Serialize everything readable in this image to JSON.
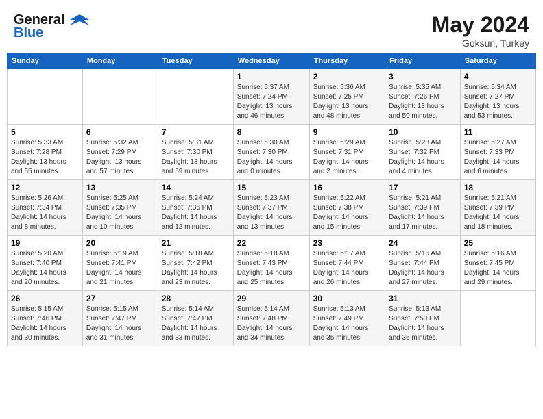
{
  "header": {
    "logo_line1": "General",
    "logo_line2": "Blue",
    "month_year": "May 2024",
    "location": "Goksun, Turkey"
  },
  "days_of_week": [
    "Sunday",
    "Monday",
    "Tuesday",
    "Wednesday",
    "Thursday",
    "Friday",
    "Saturday"
  ],
  "weeks": [
    {
      "days": [
        {
          "number": "",
          "info": ""
        },
        {
          "number": "",
          "info": ""
        },
        {
          "number": "",
          "info": ""
        },
        {
          "number": "1",
          "info": "Sunrise: 5:37 AM\nSunset: 7:24 PM\nDaylight: 13 hours\nand 46 minutes."
        },
        {
          "number": "2",
          "info": "Sunrise: 5:36 AM\nSunset: 7:25 PM\nDaylight: 13 hours\nand 48 minutes."
        },
        {
          "number": "3",
          "info": "Sunrise: 5:35 AM\nSunset: 7:26 PM\nDaylight: 13 hours\nand 50 minutes."
        },
        {
          "number": "4",
          "info": "Sunrise: 5:34 AM\nSunset: 7:27 PM\nDaylight: 13 hours\nand 53 minutes."
        }
      ]
    },
    {
      "days": [
        {
          "number": "5",
          "info": "Sunrise: 5:33 AM\nSunset: 7:28 PM\nDaylight: 13 hours\nand 55 minutes."
        },
        {
          "number": "6",
          "info": "Sunrise: 5:32 AM\nSunset: 7:29 PM\nDaylight: 13 hours\nand 57 minutes."
        },
        {
          "number": "7",
          "info": "Sunrise: 5:31 AM\nSunset: 7:30 PM\nDaylight: 13 hours\nand 59 minutes."
        },
        {
          "number": "8",
          "info": "Sunrise: 5:30 AM\nSunset: 7:30 PM\nDaylight: 14 hours\nand 0 minutes."
        },
        {
          "number": "9",
          "info": "Sunrise: 5:29 AM\nSunset: 7:31 PM\nDaylight: 14 hours\nand 2 minutes."
        },
        {
          "number": "10",
          "info": "Sunrise: 5:28 AM\nSunset: 7:32 PM\nDaylight: 14 hours\nand 4 minutes."
        },
        {
          "number": "11",
          "info": "Sunrise: 5:27 AM\nSunset: 7:33 PM\nDaylight: 14 hours\nand 6 minutes."
        }
      ]
    },
    {
      "days": [
        {
          "number": "12",
          "info": "Sunrise: 5:26 AM\nSunset: 7:34 PM\nDaylight: 14 hours\nand 8 minutes."
        },
        {
          "number": "13",
          "info": "Sunrise: 5:25 AM\nSunset: 7:35 PM\nDaylight: 14 hours\nand 10 minutes."
        },
        {
          "number": "14",
          "info": "Sunrise: 5:24 AM\nSunset: 7:36 PM\nDaylight: 14 hours\nand 12 minutes."
        },
        {
          "number": "15",
          "info": "Sunrise: 5:23 AM\nSunset: 7:37 PM\nDaylight: 14 hours\nand 13 minutes."
        },
        {
          "number": "16",
          "info": "Sunrise: 5:22 AM\nSunset: 7:38 PM\nDaylight: 14 hours\nand 15 minutes."
        },
        {
          "number": "17",
          "info": "Sunrise: 5:21 AM\nSunset: 7:39 PM\nDaylight: 14 hours\nand 17 minutes."
        },
        {
          "number": "18",
          "info": "Sunrise: 5:21 AM\nSunset: 7:39 PM\nDaylight: 14 hours\nand 18 minutes."
        }
      ]
    },
    {
      "days": [
        {
          "number": "19",
          "info": "Sunrise: 5:20 AM\nSunset: 7:40 PM\nDaylight: 14 hours\nand 20 minutes."
        },
        {
          "number": "20",
          "info": "Sunrise: 5:19 AM\nSunset: 7:41 PM\nDaylight: 14 hours\nand 21 minutes."
        },
        {
          "number": "21",
          "info": "Sunrise: 5:18 AM\nSunset: 7:42 PM\nDaylight: 14 hours\nand 23 minutes."
        },
        {
          "number": "22",
          "info": "Sunrise: 5:18 AM\nSunset: 7:43 PM\nDaylight: 14 hours\nand 25 minutes."
        },
        {
          "number": "23",
          "info": "Sunrise: 5:17 AM\nSunset: 7:44 PM\nDaylight: 14 hours\nand 26 minutes."
        },
        {
          "number": "24",
          "info": "Sunrise: 5:16 AM\nSunset: 7:44 PM\nDaylight: 14 hours\nand 27 minutes."
        },
        {
          "number": "25",
          "info": "Sunrise: 5:16 AM\nSunset: 7:45 PM\nDaylight: 14 hours\nand 29 minutes."
        }
      ]
    },
    {
      "days": [
        {
          "number": "26",
          "info": "Sunrise: 5:15 AM\nSunset: 7:46 PM\nDaylight: 14 hours\nand 30 minutes."
        },
        {
          "number": "27",
          "info": "Sunrise: 5:15 AM\nSunset: 7:47 PM\nDaylight: 14 hours\nand 31 minutes."
        },
        {
          "number": "28",
          "info": "Sunrise: 5:14 AM\nSunset: 7:47 PM\nDaylight: 14 hours\nand 33 minutes."
        },
        {
          "number": "29",
          "info": "Sunrise: 5:14 AM\nSunset: 7:48 PM\nDaylight: 14 hours\nand 34 minutes."
        },
        {
          "number": "30",
          "info": "Sunrise: 5:13 AM\nSunset: 7:49 PM\nDaylight: 14 hours\nand 35 minutes."
        },
        {
          "number": "31",
          "info": "Sunrise: 5:13 AM\nSunset: 7:50 PM\nDaylight: 14 hours\nand 36 minutes."
        },
        {
          "number": "",
          "info": ""
        }
      ]
    }
  ]
}
